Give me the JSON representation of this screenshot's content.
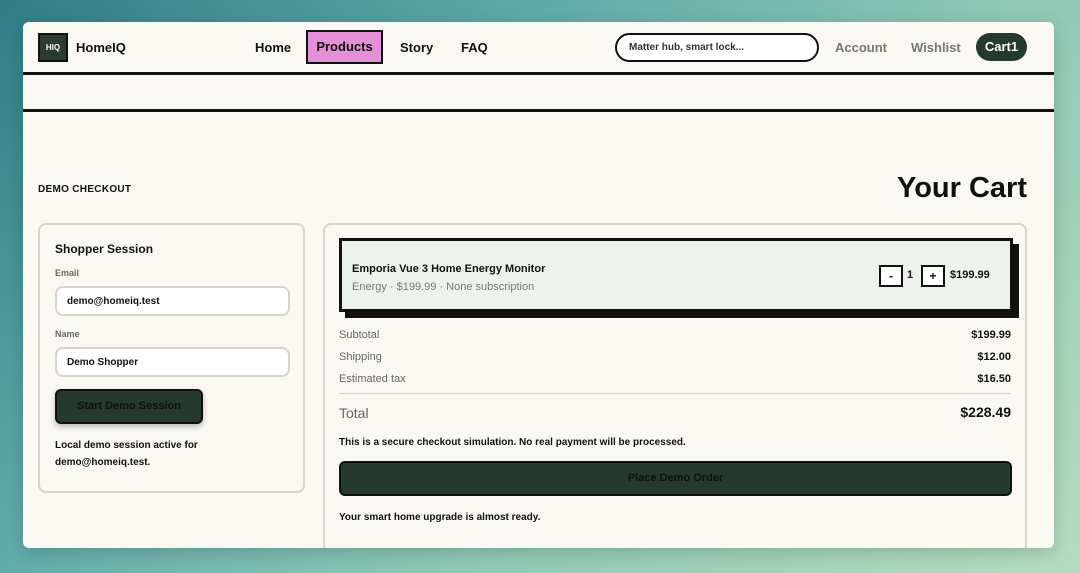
{
  "header": {
    "logo_text": "HIQ",
    "brand": "HomeIQ",
    "nav": [
      "Home",
      "Products",
      "Story",
      "FAQ"
    ],
    "search_placeholder": "Matter hub, smart lock...",
    "account": "Account",
    "wishlist": "Wishlist",
    "cart": "Cart1"
  },
  "page": {
    "eyebrow": "DEMO CHECKOUT",
    "title": "Your Cart"
  },
  "session": {
    "title": "Shopper Session",
    "email_label": "Email",
    "email_value": "demo@homeiq.test",
    "name_label": "Name",
    "name_value": "Demo Shopper",
    "start_button": "Start Demo Session",
    "status_note": "Local demo session active for demo@homeiq.test."
  },
  "cart": {
    "item": {
      "name": "Emporia Vue 3 Home Energy Monitor",
      "meta": "Energy · $199.99 · None subscription",
      "minus": "-",
      "quantity": "1",
      "plus": "+",
      "price": "$199.99"
    },
    "summary": [
      {
        "label": "Subtotal",
        "value": "$199.99"
      },
      {
        "label": "Shipping",
        "value": "$12.00"
      },
      {
        "label": "Estimated tax",
        "value": "$16.50"
      }
    ],
    "total_label": "Total",
    "total_value": "$228.49",
    "notice": "This is a secure checkout simulation. No real payment will be processed.",
    "place_button": "Place Demo Order",
    "ready_note": "Your smart home upgrade is almost ready."
  },
  "colors": {
    "accent_dark": "#243a2f",
    "active_nav": "#e58fd8",
    "page_bg": "#faf8f2"
  }
}
